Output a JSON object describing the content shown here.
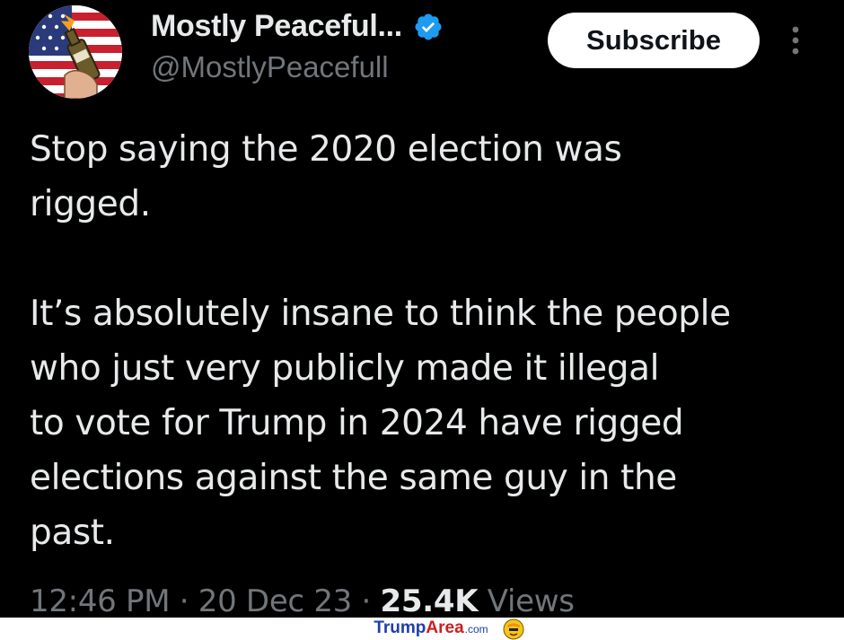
{
  "header": {
    "display_name": "Mostly Peaceful...",
    "handle": "@MostlyPeacefull",
    "verified_icon": "verified-badge-icon",
    "subscribe_label": "Subscribe",
    "more_icon": "more-vertical-icon"
  },
  "tweet": {
    "paragraphs": [
      [
        "Stop saying the 2020 election was",
        "rigged."
      ],
      [
        "It’s absolutely insane to think the people",
        "who just very publicly made it illegal",
        "to vote for Trump in 2024 have rigged",
        "elections against the same guy in the",
        "past."
      ]
    ]
  },
  "meta": {
    "time": "12:46 PM",
    "separator": " · ",
    "date": "20 Dec 23",
    "views_count": "25.4K",
    "views_label": " Views"
  },
  "watermark": {
    "part1": "Trump",
    "part2": "Area",
    "part3": ".com"
  },
  "colors": {
    "background": "#000000",
    "primary_text": "#e7e9ea",
    "secondary_text": "#71767b",
    "verified_blue": "#1d9bf0",
    "button_bg": "#ffffff"
  }
}
